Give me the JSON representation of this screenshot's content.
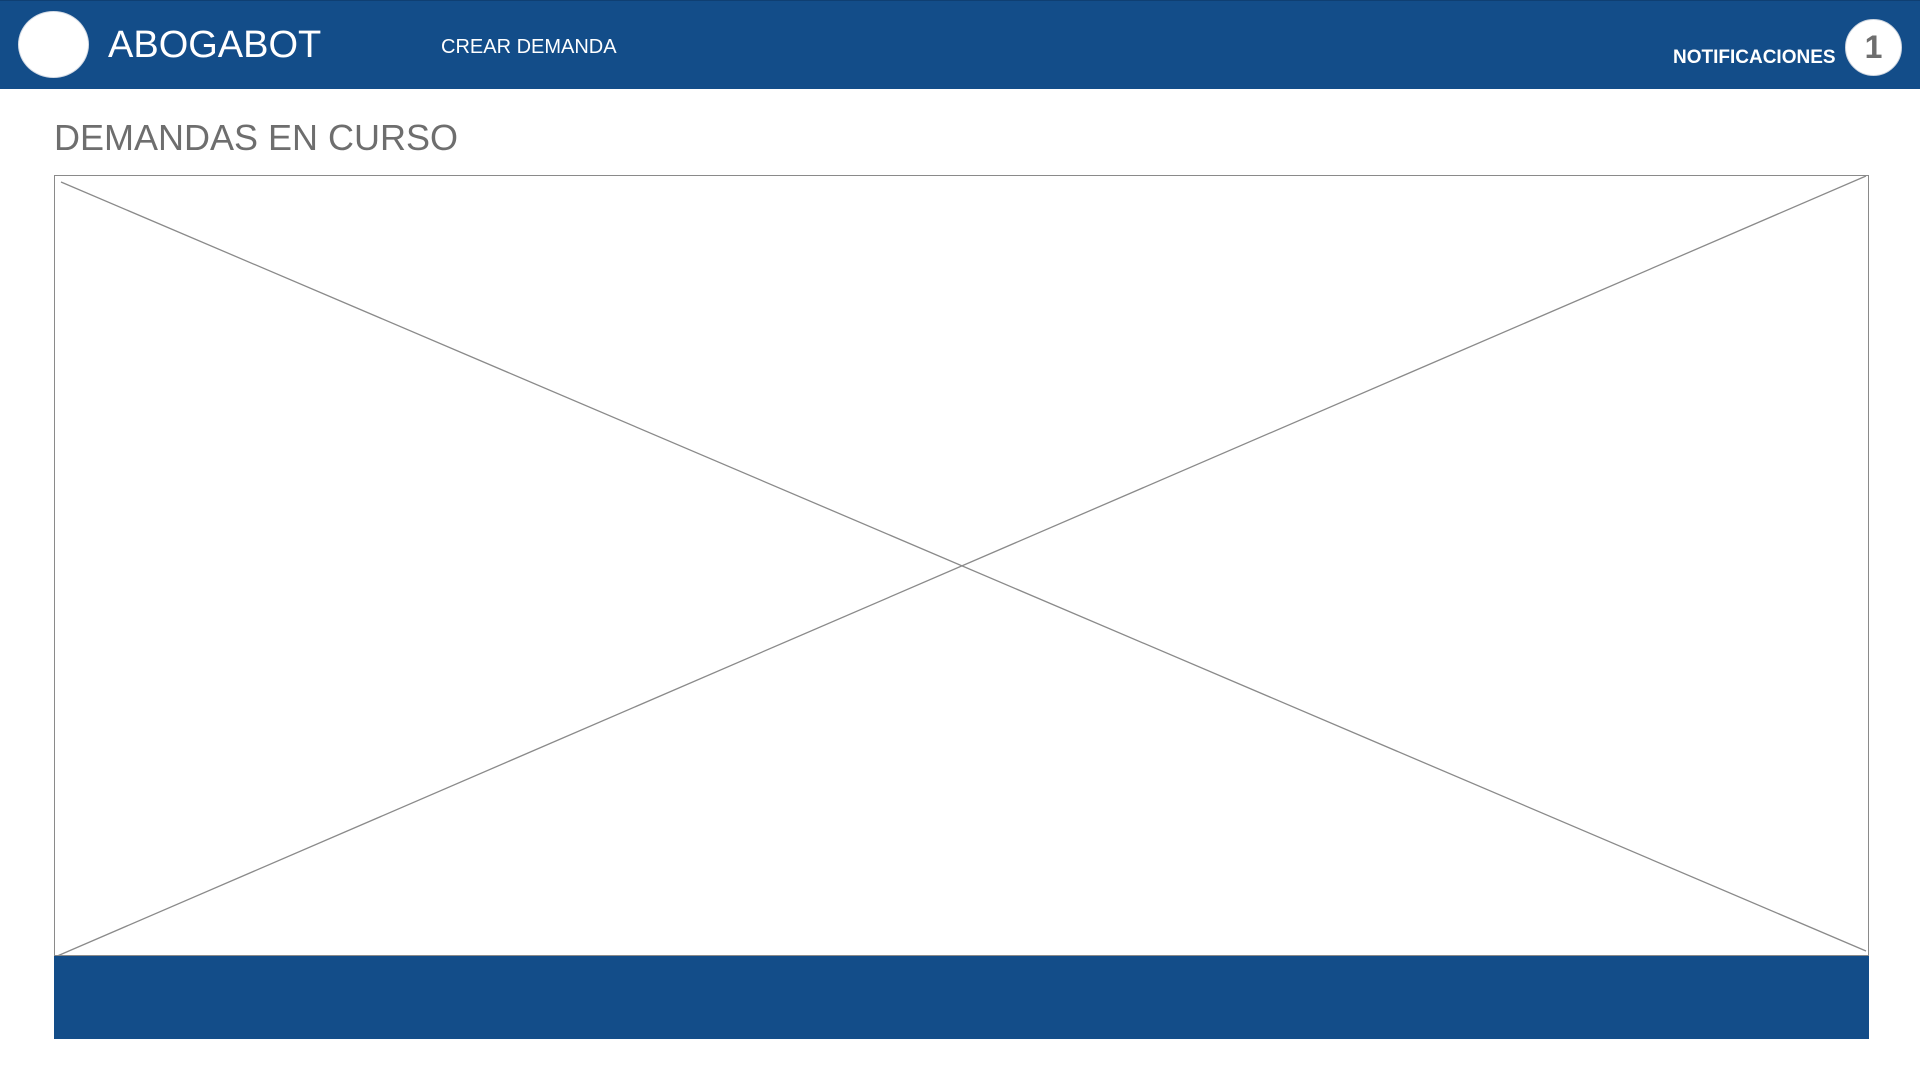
{
  "header": {
    "app_title": "ABOGABOT",
    "nav": {
      "create_label": "CREAR DEMANDA"
    },
    "notifications": {
      "label": "NOTIFICACIONES",
      "count": "1"
    }
  },
  "main": {
    "section_title": "DEMANDAS EN CURSO"
  },
  "colors": {
    "primary": "#134d89",
    "text_muted": "#6e6e6e",
    "background": "#ffffff"
  },
  "icons": {
    "logo": "logo-circle",
    "image_placeholder": "image-placeholder-icon"
  }
}
